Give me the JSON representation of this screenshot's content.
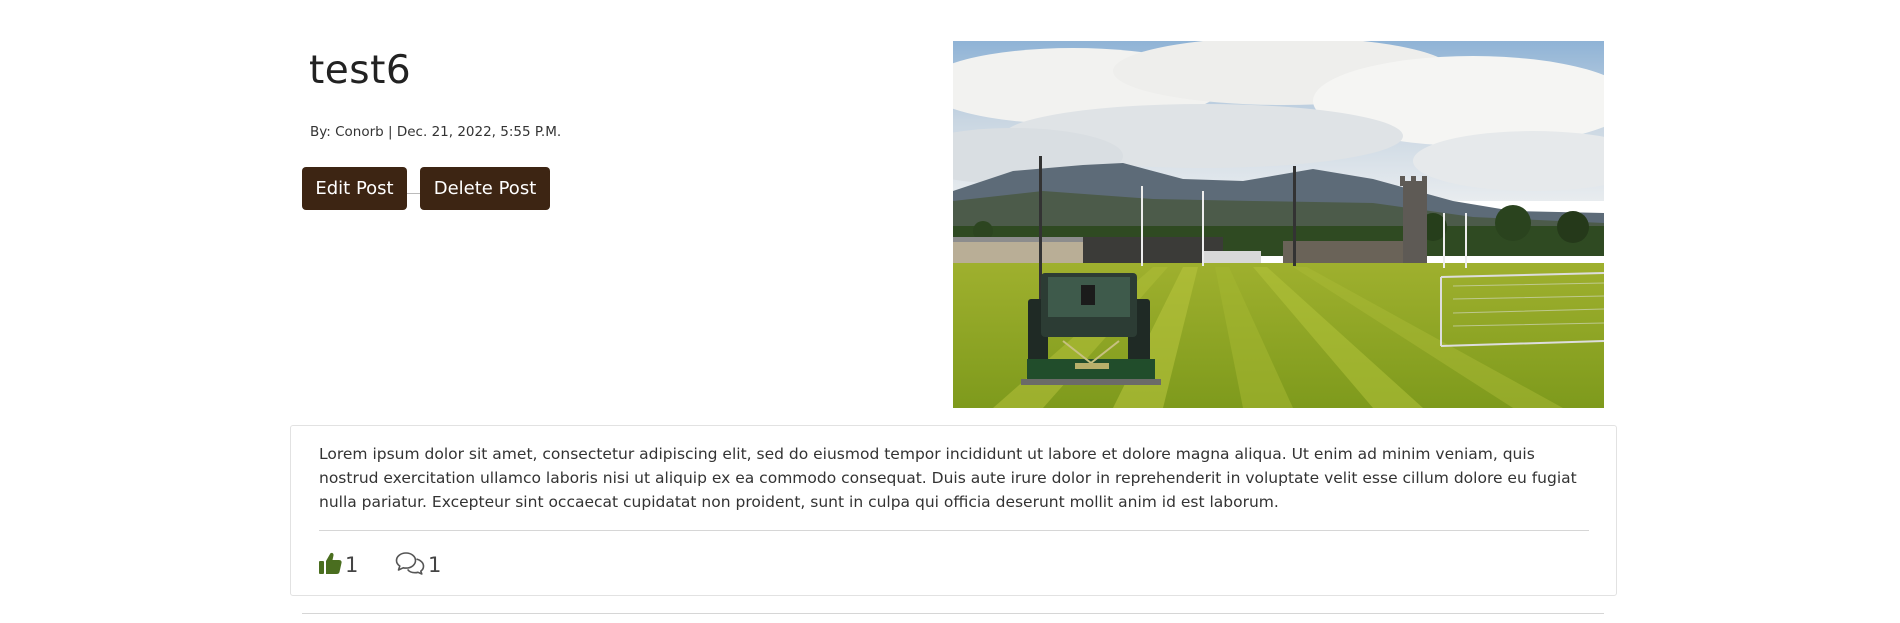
{
  "post": {
    "title": "test6",
    "meta": "By: Conorb | Dec. 21, 2022, 5:55 P.M.",
    "edit_label": "Edit Post",
    "delete_label": "Delete Post",
    "body": "Lorem ipsum dolor sit amet, consectetur adipiscing elit, sed do eiusmod tempor incididunt ut labore et dolore magna aliqua. Ut enim ad minim veniam, quis nostrud exercitation ullamco laboris nisi ut aliquip ex ea commodo consequat. Duis aute irure dolor in reprehenderit in voluptate velit esse cillum dolore eu fugiat nulla pariatur. Excepteur sint occaecat cupidatat non proident, sunt in culpa qui officia deserunt mollit anim id est laborum.",
    "like_count": "1",
    "comment_count": "1"
  },
  "icons": {
    "like": "thumbs-up-icon",
    "comments": "comments-icon"
  },
  "colors": {
    "button_bg": "#3d2513",
    "button_text": "#ffffff",
    "like_icon": "#4a6e1f",
    "comment_icon": "#555555"
  }
}
